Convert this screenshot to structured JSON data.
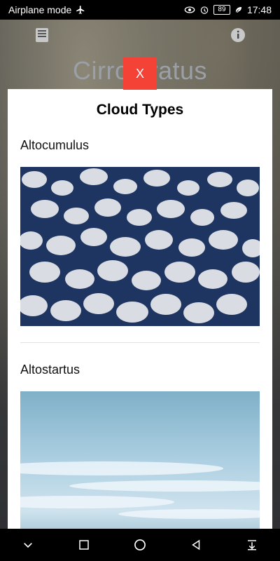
{
  "status_bar": {
    "left_text": "Airplane mode",
    "battery": "89",
    "time": "17:48"
  },
  "background_page": {
    "title": "Cirrostratus"
  },
  "modal": {
    "close_label": "X",
    "title": "Cloud Types",
    "items": [
      {
        "name": "Altocumulus"
      },
      {
        "name": "Altostartus"
      }
    ]
  },
  "colors": {
    "close_button": "#f44336",
    "modal_bg": "#ffffff",
    "status_bar_bg": "#000000"
  }
}
